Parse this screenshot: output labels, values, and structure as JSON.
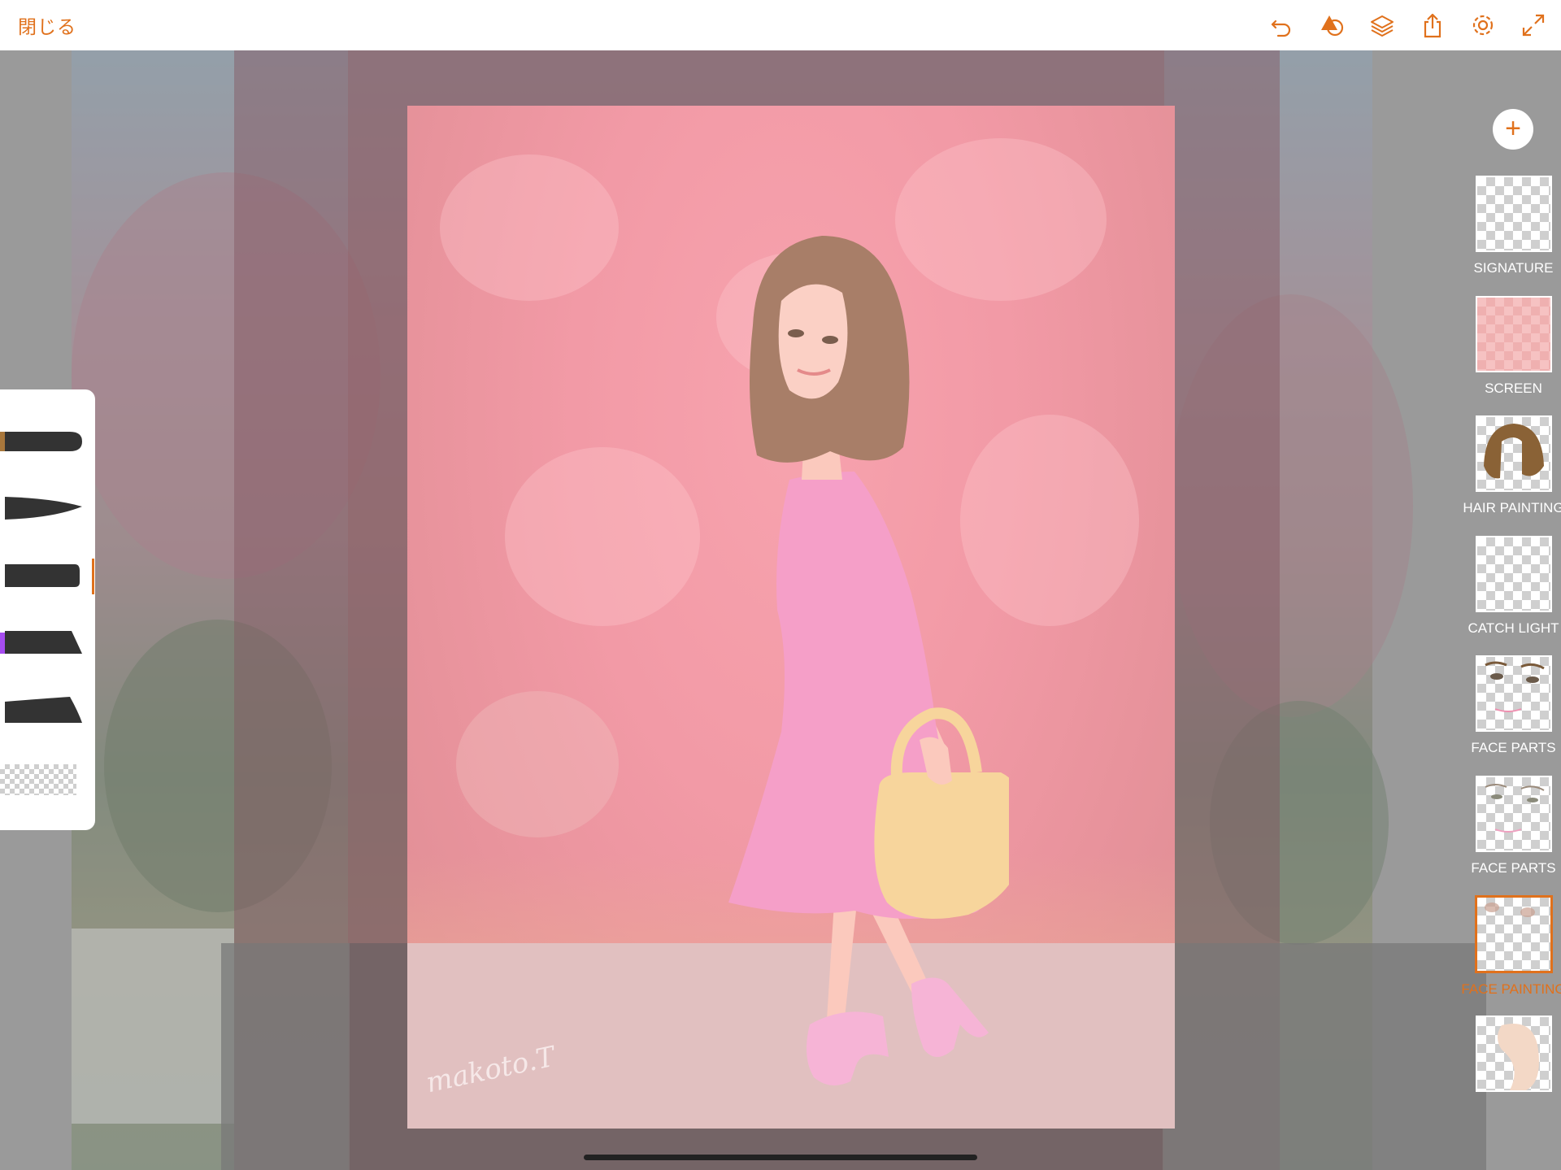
{
  "app": {
    "close_label": "閉じる",
    "accent_color": "#e0711c"
  },
  "toolbar": {
    "icons": [
      "undo-icon",
      "shapes-icon",
      "layers-icon",
      "share-icon",
      "settings-icon",
      "fullscreen-icon"
    ]
  },
  "canvas": {
    "signature_text": "makoto.T"
  },
  "brushes": {
    "items": [
      "brush-1",
      "brush-2",
      "brush-3",
      "brush-4",
      "brush-5",
      "eraser"
    ],
    "active_index": 2
  },
  "layers": {
    "add_label": "+",
    "items": [
      {
        "label": "SIGNATURE"
      },
      {
        "label": "SCREEN"
      },
      {
        "label": "HAIR PAINTING"
      },
      {
        "label": "CATCH LIGHT"
      },
      {
        "label": "FACE PARTS"
      },
      {
        "label": "FACE PARTS"
      },
      {
        "label": "FACE PAINTING",
        "active": true
      },
      {
        "label": ""
      }
    ]
  }
}
